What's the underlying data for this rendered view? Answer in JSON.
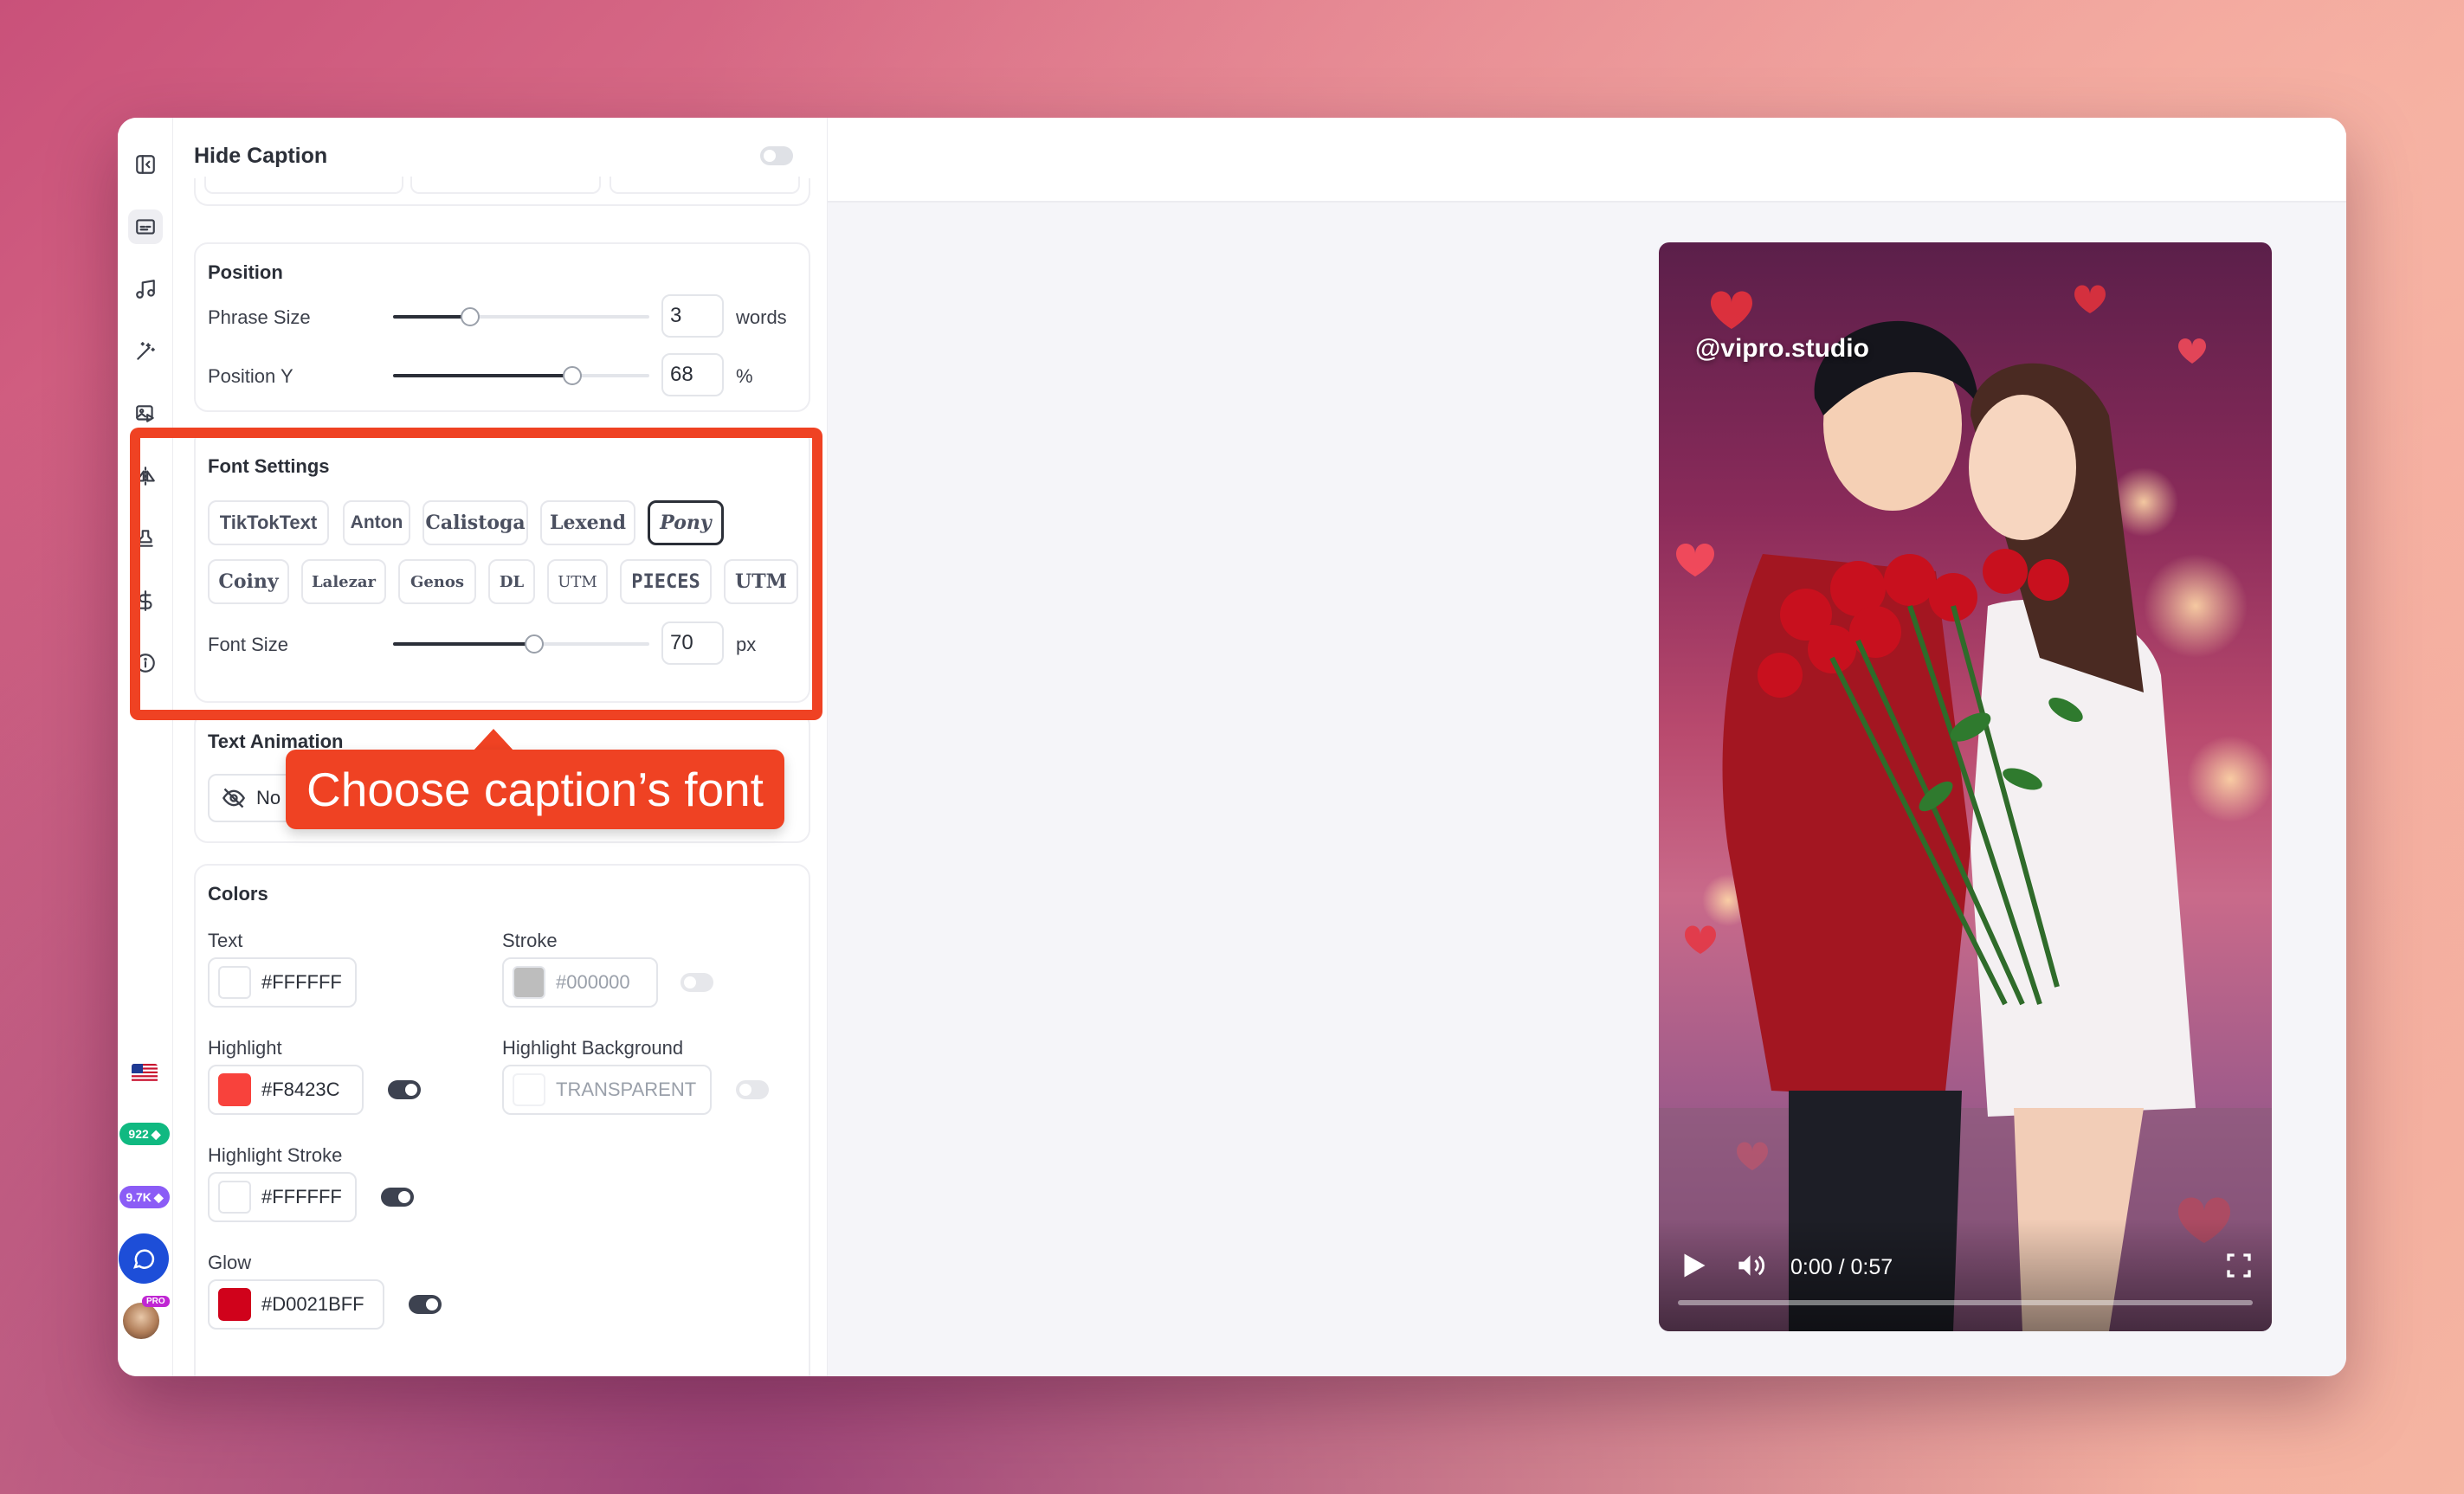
{
  "panel": {
    "title": "Hide Caption",
    "position": {
      "title": "Position",
      "phrase_size": {
        "label": "Phrase Size",
        "value": "3",
        "unit": "words",
        "fraction": 0.3
      },
      "position_y": {
        "label": "Position Y",
        "value": "68",
        "unit": "%",
        "fraction": 0.7
      }
    },
    "font_settings": {
      "title": "Font Settings",
      "fonts": [
        "TikTokText",
        "Anton",
        "Calistoga",
        "Lexend",
        "Pony",
        "Coiny",
        "Lalezar",
        "Genos",
        "DL",
        "UTM",
        "PIECES",
        "UTM"
      ],
      "selected": "Pony",
      "font_size": {
        "label": "Font Size",
        "value": "70",
        "unit": "px",
        "fraction": 0.55
      }
    },
    "text_animation": {
      "title": "Text Animation",
      "option_label": "No"
    },
    "colors": {
      "title": "Colors",
      "text": {
        "label": "Text",
        "value": "#FFFFFF",
        "swatch": "#FFFFFF"
      },
      "stroke": {
        "label": "Stroke",
        "value": "#000000",
        "swatch": "#BDBDBD",
        "enabled": false
      },
      "highlight": {
        "label": "Highlight",
        "value": "#F8423C",
        "swatch": "#F8423C",
        "enabled": true
      },
      "highlight_background": {
        "label": "Highlight Background",
        "value": "TRANSPARENT",
        "swatch": "#FFFFFF",
        "enabled": false
      },
      "highlight_stroke": {
        "label": "Highlight Stroke",
        "value": "#FFFFFF",
        "swatch": "#FFFFFF",
        "enabled": true
      },
      "glow": {
        "label": "Glow",
        "value": "#D0021BFF",
        "swatch": "#D0021B",
        "enabled": true
      }
    }
  },
  "callout": {
    "text": "Choose caption’s font",
    "color": "#EF4223"
  },
  "rail": {
    "badges": [
      {
        "text": "922",
        "color": "#10b981"
      },
      {
        "text": "9.7K",
        "color": "#8b5cf6"
      }
    ],
    "pro_label": "PRO"
  },
  "video": {
    "watermark": "@vipro.studio",
    "time": "0:00 / 0:57",
    "progress_fraction": 0
  }
}
